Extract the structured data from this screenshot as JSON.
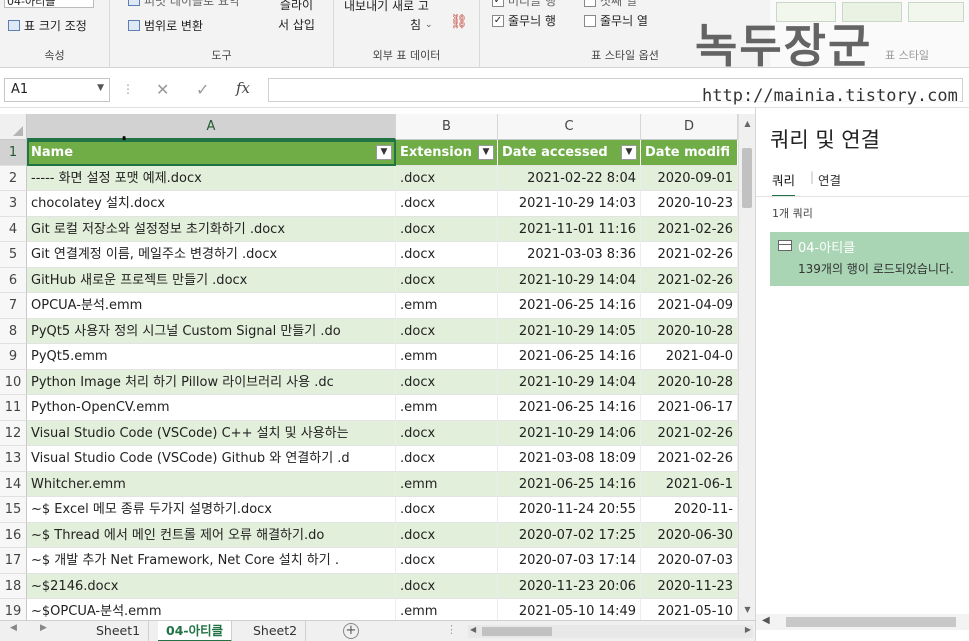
{
  "ribbon": {
    "props": {
      "tablename_value": "04-아티클",
      "resize_label": "표 크기 조정",
      "group_label": "속성"
    },
    "tools": {
      "pivot_label": "피벗 테이블로 요약",
      "convert_label": "범위로 변환",
      "slicer_label_1": "슬라이",
      "slicer_label_2": "서 삽입",
      "group_label": "도구"
    },
    "external": {
      "export_label": "내보내기 새로 고",
      "refresh_label": "침",
      "group_label": "외부 표 데이터"
    },
    "style_options": {
      "header_row": "머리글 행",
      "first_col": "첫째 열",
      "banded_rows": "줄무늬 행",
      "banded_cols": "줄무늬 열",
      "group_label": "표 스타일 옵션"
    },
    "styles": {
      "group_label": "표 스타일"
    },
    "watermark": "녹두장군",
    "watermark_url": "http://mainia.tistory.com"
  },
  "formula_bar": {
    "name_box": "A1",
    "cancel_icon": "✕",
    "enter_icon": "✓",
    "fx_label": "fx",
    "value": ""
  },
  "grid": {
    "columns": [
      "A",
      "B",
      "C",
      "D"
    ],
    "header": {
      "name": "Name",
      "extension": "Extension",
      "accessed": "Date accessed",
      "modified": "Date modifi"
    },
    "rows": [
      {
        "n": "2",
        "name": "----- 화면 설정 포맷 예제.docx",
        "ext": ".docx",
        "acc": "2021-02-22 8:04",
        "mod": "2020-09-01"
      },
      {
        "n": "3",
        "name": "chocolatey 설치.docx",
        "ext": ".docx",
        "acc": "2021-10-29 14:03",
        "mod": "2020-10-23"
      },
      {
        "n": "4",
        "name": "Git 로컬 저장소와 설정정보 초기화하기 .docx",
        "ext": ".docx",
        "acc": "2021-11-01 11:16",
        "mod": "2021-02-26"
      },
      {
        "n": "5",
        "name": "Git 연결계정 이름, 메일주소 변경하기 .docx",
        "ext": ".docx",
        "acc": "2021-03-03 8:36",
        "mod": "2021-02-26"
      },
      {
        "n": "6",
        "name": "GitHub 새로운 프로젝트 만들기 .docx",
        "ext": ".docx",
        "acc": "2021-10-29 14:04",
        "mod": "2021-02-26"
      },
      {
        "n": "7",
        "name": "OPCUA-분석.emm",
        "ext": ".emm",
        "acc": "2021-06-25 14:16",
        "mod": "2021-04-09"
      },
      {
        "n": "8",
        "name": "PyQt5 사용자 정의 시그널 Custom Signal 만들기 .do",
        "ext": ".docx",
        "acc": "2021-10-29 14:05",
        "mod": "2020-10-28"
      },
      {
        "n": "9",
        "name": "PyQt5.emm",
        "ext": ".emm",
        "acc": "2021-06-25 14:16",
        "mod": "2021-04-0"
      },
      {
        "n": "10",
        "name": "Python Image 처리 하기 Pillow 라이브러리 사용 .dc",
        "ext": ".docx",
        "acc": "2021-10-29 14:04",
        "mod": "2020-10-28"
      },
      {
        "n": "11",
        "name": "Python-OpenCV.emm",
        "ext": ".emm",
        "acc": "2021-06-25 14:16",
        "mod": "2021-06-17"
      },
      {
        "n": "12",
        "name": "Visual Studio Code (VSCode) C++ 설치 및 사용하는",
        "ext": ".docx",
        "acc": "2021-10-29 14:06",
        "mod": "2021-02-26"
      },
      {
        "n": "13",
        "name": "Visual Studio Code (VSCode) Github 와 연결하기 .d",
        "ext": ".docx",
        "acc": "2021-03-08 18:09",
        "mod": "2021-02-26"
      },
      {
        "n": "14",
        "name": "Whitcher.emm",
        "ext": ".emm",
        "acc": "2021-06-25 14:16",
        "mod": "2021-06-1"
      },
      {
        "n": "15",
        "name": "~$ Excel 메모 종류 두가지 설명하기.docx",
        "ext": ".docx",
        "acc": "2020-11-24 20:55",
        "mod": "2020-11-"
      },
      {
        "n": "16",
        "name": "~$ Thread 에서 메인 컨트롤 제어 오류 해결하기.do",
        "ext": ".docx",
        "acc": "2020-07-02 17:25",
        "mod": "2020-06-30"
      },
      {
        "n": "17",
        "name": "~$ 개발 추가 Net Framework, Net Core 설치 하기 .",
        "ext": ".docx",
        "acc": "2020-07-03 17:14",
        "mod": "2020-07-03"
      },
      {
        "n": "18",
        "name": "~$2146.docx",
        "ext": ".docx",
        "acc": "2020-11-23 20:06",
        "mod": "2020-11-23"
      },
      {
        "n": "19",
        "name": "~$OPCUA-분석.emm",
        "ext": ".emm",
        "acc": "2021-05-10 14:49",
        "mod": "2021-05-10"
      }
    ]
  },
  "tabs": [
    "Sheet1",
    "04-아티클",
    "Sheet2"
  ],
  "active_tab": "04-아티클",
  "pane": {
    "title": "쿼리 및 연결",
    "tab_queries": "쿼리",
    "tab_connections": "연결",
    "count": "1개 쿼리",
    "query_name": "04-아티클",
    "query_desc": "139개의 행이 로드되었습니다."
  },
  "colors": {
    "header_green": "#70ad47",
    "band_green": "#e2efda",
    "accent": "#217346"
  }
}
